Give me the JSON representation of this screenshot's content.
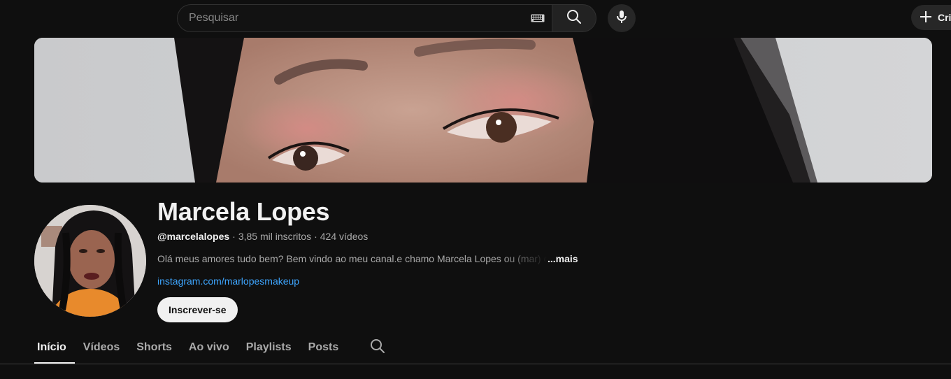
{
  "search": {
    "placeholder": "Pesquisar",
    "keyboard_icon": "keyboard-icon",
    "search_icon": "search-icon",
    "mic_icon": "mic-icon"
  },
  "header": {
    "create_label": "Cri",
    "create_icon": "plus-icon"
  },
  "channel": {
    "name": "Marcela Lopes",
    "handle": "@marcelalopes",
    "separator": "·",
    "subscribers": "3,85 mil inscritos",
    "videos": "424 vídeos",
    "description": "Olá meus amores tudo bem? Bem vindo ao meu canal.e chamo Marcela Lopes ou (mar) c",
    "more_label": "...mais",
    "link": "instagram.com/marlopesmakeup",
    "subscribe_label": "Inscrever-se"
  },
  "tabs": [
    {
      "label": "Início",
      "active": true
    },
    {
      "label": "Vídeos",
      "active": false
    },
    {
      "label": "Shorts",
      "active": false
    },
    {
      "label": "Ao vivo",
      "active": false
    },
    {
      "label": "Playlists",
      "active": false
    },
    {
      "label": "Posts",
      "active": false
    }
  ],
  "colors": {
    "background": "#0f0f0f",
    "text_primary": "#f1f1f1",
    "text_secondary": "#aaaaaa",
    "link": "#3ea6ff",
    "subscribe_bg": "#f1f1f1"
  }
}
